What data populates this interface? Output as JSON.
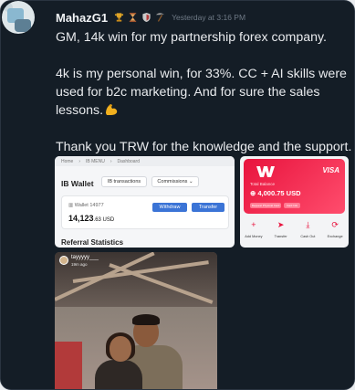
{
  "post": {
    "username": "MahazG1",
    "timestamp": "Yesterday at 3:16 PM",
    "badges": [
      "trophy-badge",
      "hourglass-badge",
      "shield-badge",
      "pickaxe-badge"
    ],
    "line1": "GM, 14k win for my partnership forex company.",
    "line2": "4k is my personal win, for 33%. CC + AI skills were used for b2c marketing. And for sure the sales lessons.",
    "emoji": "flexed-biceps",
    "line3": "Thank you TRW for the knowledge and the support."
  },
  "ib_wallet_screenshot": {
    "breadcrumb": [
      "Home",
      "IB MENU",
      "Dashboard"
    ],
    "title": "IB Wallet",
    "tab_transactions": "IB transactions",
    "tab_commissions": "Commissions",
    "wallet_id": "Wallet 14977",
    "amount_main": "14,123",
    "amount_fraction": ".63 USD",
    "withdraw_label": "Withdraw",
    "transfer_label": "Transfer",
    "section_title": "Referral Statistics"
  },
  "card_screenshot": {
    "brand": "VISA",
    "balance_label": "Total Balance",
    "balance": "4,000.75 USD",
    "card_btn1": "Request Physical Card",
    "card_btn2": "Card Info",
    "actions": [
      {
        "icon": "+",
        "label": "Add Money"
      },
      {
        "icon": "➤",
        "label": "Transfer"
      },
      {
        "icon": "⤓",
        "label": "Cash Out"
      },
      {
        "icon": "⟳",
        "label": "Exchange"
      }
    ],
    "accent": "#e8133d"
  },
  "photo_screenshot": {
    "story_user": "tayyyyy___",
    "story_time": "19m ago"
  }
}
